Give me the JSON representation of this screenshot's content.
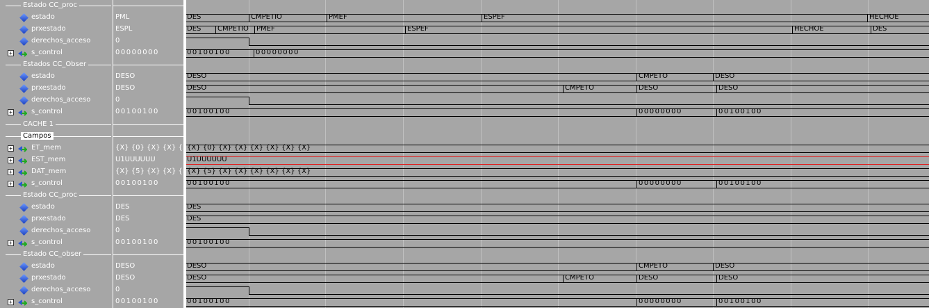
{
  "signals": [
    {
      "kind": "group",
      "label": "Estado CC_proc"
    },
    {
      "kind": "sig",
      "label": "estado",
      "value": "PML",
      "wave": [
        [
          "DES",
          0
        ],
        [
          "CMPETIO",
          90
        ],
        [
          "PMEF",
          202
        ],
        [
          "ESPEF",
          425
        ],
        [
          "HECHOE",
          980
        ]
      ]
    },
    {
      "kind": "sig",
      "label": "prxestado",
      "value": "ESPL",
      "wave": [
        [
          "DES",
          0
        ],
        [
          "CMPETIO",
          42
        ],
        [
          "PMEF",
          98
        ],
        [
          "ESPEF",
          315
        ],
        [
          "HECHOE",
          872
        ],
        [
          "DES",
          985
        ]
      ]
    },
    {
      "kind": "bit",
      "label": "derechos_acceso",
      "value": "0"
    },
    {
      "kind": "bus",
      "label": "s_control",
      "value": "00000000",
      "wave": [
        [
          "00100100",
          0
        ],
        [
          "00000000",
          97
        ]
      ]
    },
    {
      "kind": "group",
      "label": "Estados CC_Obser"
    },
    {
      "kind": "sig",
      "label": "estado",
      "value": "DESO",
      "wave": [
        [
          "DESO",
          0
        ],
        [
          "CMPETO",
          648
        ],
        [
          "DESO",
          758
        ]
      ]
    },
    {
      "kind": "sig",
      "label": "prxestado",
      "value": "DESO",
      "wave": [
        [
          "DESO",
          0
        ],
        [
          "CMPETO",
          542
        ],
        [
          "DESO",
          648
        ],
        [
          "DESO",
          763
        ]
      ]
    },
    {
      "kind": "bit",
      "label": "derechos_acceso",
      "value": "0"
    },
    {
      "kind": "bus",
      "label": "s_control",
      "value": "00100100",
      "wave": [
        [
          "00100100",
          0
        ],
        [
          "00000000",
          648
        ],
        [
          "00100100",
          763
        ]
      ]
    },
    {
      "kind": "group",
      "label": "CACHE 1"
    },
    {
      "kind": "group",
      "label": "Campos",
      "white": true
    },
    {
      "kind": "bus",
      "label": "ET_mem",
      "value": "{X} {0} {X} {X} {...",
      "wave": [
        [
          "{X} {0} {X} {X} {X} {X} {X} {X}",
          0
        ]
      ]
    },
    {
      "kind": "bus",
      "label": "EST_mem",
      "value": "U1UUUUUU",
      "red": true,
      "wave": [
        [
          "U1UUUUUU",
          0
        ]
      ]
    },
    {
      "kind": "bus",
      "label": "DAT_mem",
      "value": "{X} {5} {X} {X} {...",
      "wave": [
        [
          "{X} {5} {X} {X} {X} {X} {X} {X}",
          0
        ]
      ]
    },
    {
      "kind": "bus",
      "label": "s_control",
      "value": "00100100",
      "wave": [
        [
          "00100100",
          0
        ],
        [
          "00000000",
          648
        ],
        [
          "00100100",
          763
        ]
      ]
    },
    {
      "kind": "group",
      "label": "Estado CC_proc"
    },
    {
      "kind": "sig",
      "label": "estado",
      "value": "DES",
      "wave": [
        [
          "DES",
          0
        ]
      ]
    },
    {
      "kind": "sig",
      "label": "prxestado",
      "value": "DES",
      "wave": [
        [
          "DES",
          0
        ]
      ]
    },
    {
      "kind": "bit",
      "label": "derechos_acceso",
      "value": "0"
    },
    {
      "kind": "bus",
      "label": "s_control",
      "value": "00100100",
      "wave": [
        [
          "00100100",
          0
        ]
      ]
    },
    {
      "kind": "group",
      "label": "Estado CC_obser"
    },
    {
      "kind": "sig",
      "label": "estado",
      "value": "DESO",
      "wave": [
        [
          "DESO",
          0
        ],
        [
          "CMPETO",
          648
        ],
        [
          "DESO",
          758
        ]
      ]
    },
    {
      "kind": "sig",
      "label": "prxestado",
      "value": "DESO",
      "wave": [
        [
          "DESO",
          0
        ],
        [
          "CMPETO",
          542
        ],
        [
          "DESO",
          648
        ],
        [
          "DESO",
          763
        ]
      ]
    },
    {
      "kind": "bit",
      "label": "derechos_acceso",
      "value": "0"
    },
    {
      "kind": "bus",
      "label": "s_control",
      "value": "00100100",
      "wave": [
        [
          "00100100",
          0
        ],
        [
          "00000000",
          648
        ],
        [
          "00100100",
          763
        ]
      ]
    }
  ],
  "bit_drop_at": 90,
  "grid_x": [
    90,
    200,
    312,
    424,
    535,
    647,
    758,
    870,
    981
  ]
}
